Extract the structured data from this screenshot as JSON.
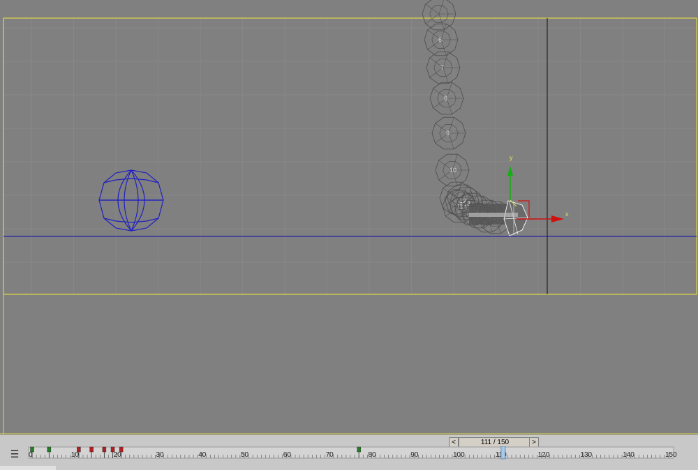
{
  "viewport": {
    "trail_labels": [
      "6",
      "7",
      "8",
      "9",
      "10",
      "11",
      "12",
      "13",
      "14",
      "15",
      "16",
      "17"
    ],
    "gizmo": {
      "x_label": "x",
      "y_label": "y"
    },
    "colors": {
      "grid": "#8a8a8a",
      "frame_border": "#e0d84a",
      "horizon": "#2222aa",
      "wireframe": "#2020c0",
      "trail": "#505050"
    }
  },
  "timeline": {
    "current_frame": "111 / 150",
    "prev_label": "<",
    "next_label": ">",
    "total_frames": 150,
    "current": 111,
    "tick_labels": [
      "0",
      "10",
      "20",
      "30",
      "40",
      "50",
      "60",
      "70",
      "80",
      "90",
      "100",
      "110",
      "120",
      "130",
      "140",
      "150"
    ],
    "key_frames_red": [
      11,
      14,
      17,
      19,
      21
    ],
    "key_frames_green": [
      0,
      4,
      77
    ]
  }
}
